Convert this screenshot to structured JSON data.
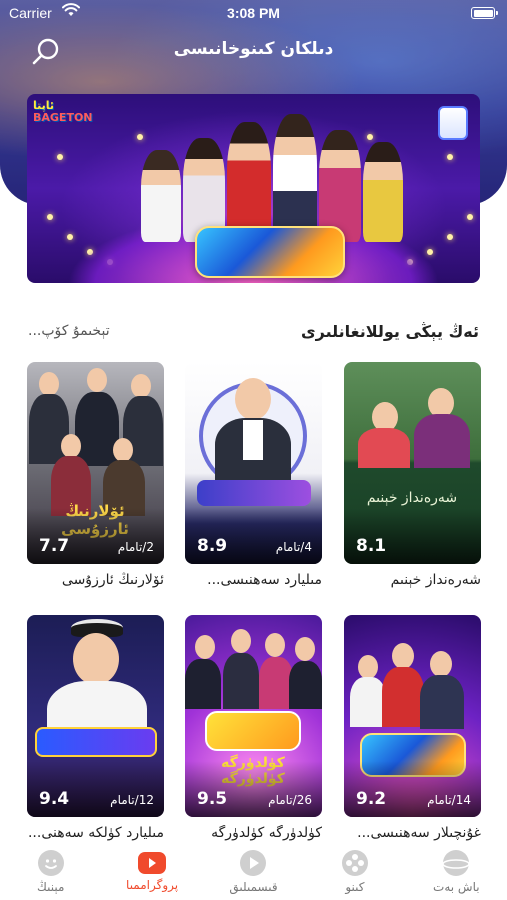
{
  "status_bar": {
    "carrier": "Carrier",
    "time": "3:08 PM"
  },
  "nav": {
    "title": "دىلكان كىنوخانىسى"
  },
  "section": {
    "title": "ئەڭ يېڭى يوللانغانلىرى",
    "see_more": "تېخىمۇ كۆپ..."
  },
  "cards": [
    {
      "title": "شەرەنداز خېنىم",
      "rating": "8.1",
      "episodes": ""
    },
    {
      "title": "مىليارد سەھنىسى...",
      "rating": "8.9",
      "episodes": "4/تامام"
    },
    {
      "title": "ئۆلارنىڭ ئارزۇسى",
      "rating": "7.7",
      "episodes": "2/تامام"
    },
    {
      "title": "غۇنچىلار سەھنىسى...",
      "rating": "9.2",
      "episodes": "14/تامام"
    },
    {
      "title": "كۈلدۈرگە كۈلدۈرگە",
      "rating": "9.5",
      "episodes": "26/تامام"
    },
    {
      "title": "مىليارد كۈلكە سەھنى...",
      "rating": "9.4",
      "episodes": "12/تامام"
    }
  ],
  "tabs": [
    {
      "label": "باش بەت",
      "icon": "planet-icon",
      "active": false
    },
    {
      "label": "كىنو",
      "icon": "film-reel-icon",
      "active": false
    },
    {
      "label": "قىسمىلىق",
      "icon": "play-circle-icon",
      "active": false
    },
    {
      "label": "پروگراممىا",
      "icon": "tv-program-icon",
      "active": true
    },
    {
      "label": "مېنىڭ",
      "icon": "smiley-face-icon",
      "active": false
    }
  ],
  "colors": {
    "accent": "#f04a2c",
    "inactive": "#777777"
  }
}
